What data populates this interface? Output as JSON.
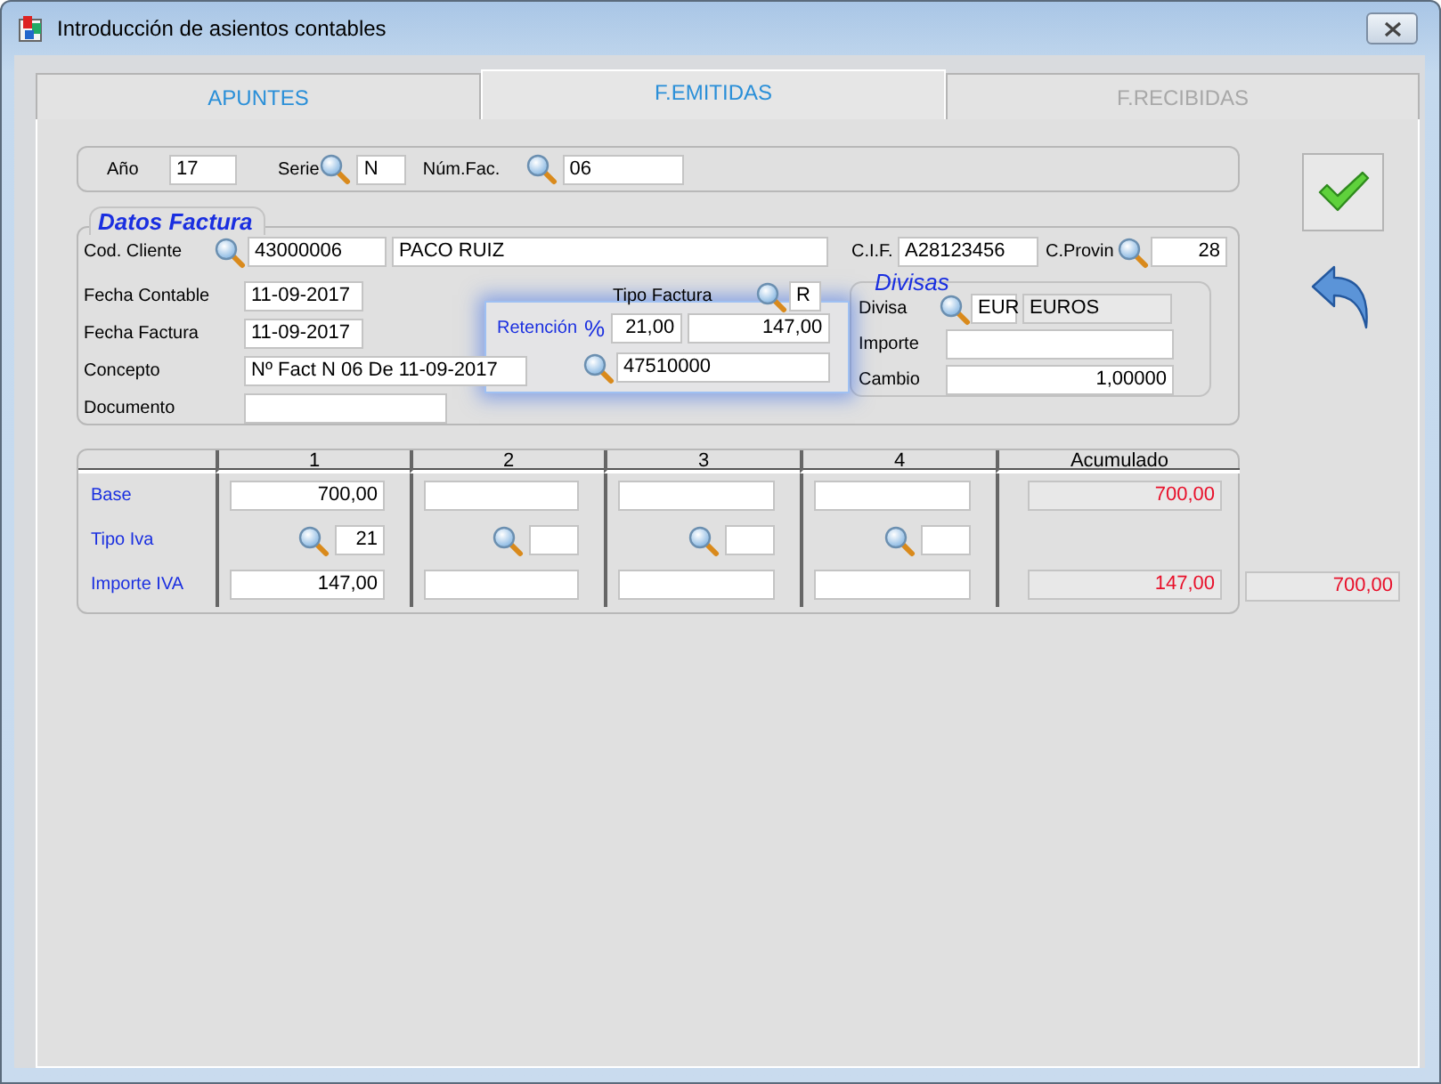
{
  "window": {
    "title": "Introducción de asientos contables"
  },
  "tabs": [
    {
      "label": "APUNTES",
      "selected": false,
      "disabled": false
    },
    {
      "label": "F.EMITIDAS",
      "selected": true,
      "disabled": false
    },
    {
      "label": "F.RECIBIDAS",
      "selected": false,
      "disabled": true
    }
  ],
  "header": [
    {
      "label": "Año",
      "value": "17",
      "lookup": false
    },
    {
      "label": "Serie",
      "value": "N",
      "lookup": true
    },
    {
      "label": "Núm.Fac.",
      "value": "06",
      "lookup": true
    }
  ],
  "datos_factura": {
    "title": "Datos Factura",
    "cod_cliente": {
      "label": "Cod. Cliente",
      "code": "43000006",
      "name": "PACO RUIZ"
    },
    "cif": {
      "label": "C.I.F.",
      "value": "A28123456"
    },
    "c_provin": {
      "label": "C.Provin",
      "value": "28"
    },
    "fecha_contable": {
      "label": "Fecha Contable",
      "value": "11-09-2017"
    },
    "tipo_factura": {
      "label": "Tipo Factura",
      "value": "R"
    },
    "fecha_factura": {
      "label": "Fecha Factura",
      "value": "11-09-2017"
    },
    "concepto": {
      "label": "Concepto",
      "value": "Nº Fact N 06 De 11-09-2017"
    },
    "documento": {
      "label": "Documento"
    }
  },
  "retencion": {
    "label": "Retención",
    "unit": "%",
    "rate": "21,00",
    "amount": "147,00",
    "account": "47510000"
  },
  "divisas": {
    "title": "Divisas",
    "divisa": {
      "label": "Divisa",
      "code": "EUR",
      "name": "EUROS"
    },
    "importe": {
      "label": "Importe"
    },
    "cambio": {
      "label": "Cambio",
      "value": "1,00000"
    }
  },
  "iva_table": {
    "columns": [
      "1",
      "2",
      "3",
      "4",
      "Acumulado"
    ],
    "rows": [
      {
        "kind": "amount",
        "label": "Base",
        "cells": [
          {
            "value": "700,00"
          },
          {},
          {},
          {}
        ],
        "total": "700,00"
      },
      {
        "kind": "rate",
        "label": "Tipo Iva",
        "cells": [
          {
            "value": "21"
          },
          {},
          {},
          {}
        ]
      },
      {
        "kind": "amount",
        "label": "Importe IVA",
        "cells": [
          {
            "value": "147,00"
          },
          {},
          {},
          {}
        ],
        "total": "147,00"
      }
    ]
  },
  "grand_total": "700,00"
}
